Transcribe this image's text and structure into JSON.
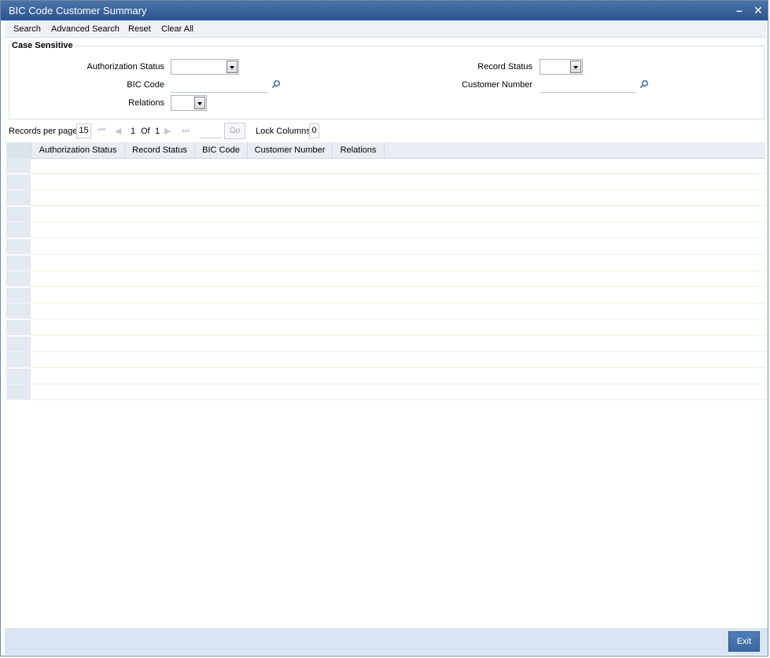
{
  "window": {
    "title": "BIC Code Customer Summary",
    "minimize": "–",
    "close": "✕"
  },
  "toolbar": {
    "search": "Search",
    "advanced_search": "Advanced Search",
    "reset": "Reset",
    "clear_all": "Clear All"
  },
  "search_panel": {
    "legend": "Case Sensitive",
    "authorization_status_label": "Authorization Status",
    "authorization_status_value": "",
    "bic_code_label": "BIC Code",
    "bic_code_value": "",
    "relations_label": "Relations",
    "relations_value": "",
    "record_status_label": "Record Status",
    "record_status_value": "",
    "customer_number_label": "Customer Number",
    "customer_number_value": ""
  },
  "pager": {
    "records_per_page_label": "Records per page",
    "records_per_page": "15",
    "current_page": "1",
    "of_label": "Of",
    "total_pages": "1",
    "go_label": "Go",
    "lock_columns_label": "Lock Columns",
    "lock_columns": "0"
  },
  "grid": {
    "columns": [
      "Authorization Status",
      "Record Status",
      "BIC Code",
      "Customer Number",
      "Relations"
    ]
  },
  "footer": {
    "exit": "Exit"
  },
  "icons": {
    "search_lens": "magnifier-icon"
  },
  "colors": {
    "titlebar": "#2a5592",
    "footer": "#d9e5f2",
    "exit_button": "#4f7fb8"
  }
}
